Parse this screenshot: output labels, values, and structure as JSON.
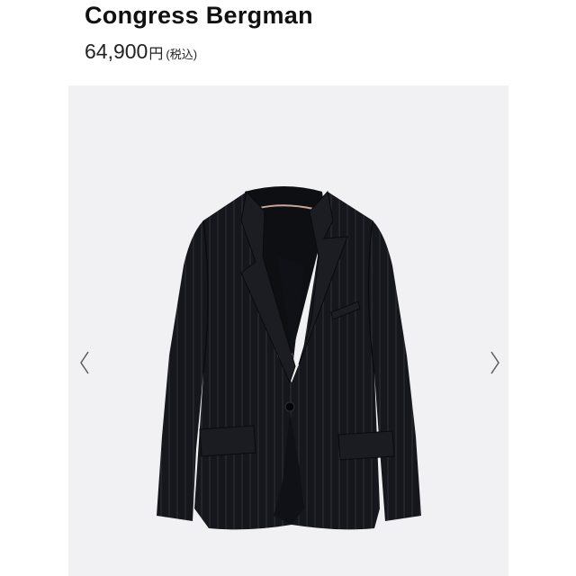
{
  "product": {
    "title": "Congress Bergman",
    "price": "64,900",
    "currency": "円",
    "tax_note": "(税込)"
  },
  "gallery": {
    "image_subject": "jacket-photo",
    "prev_icon": "chevron-left-icon",
    "next_icon": "chevron-right-icon",
    "background_color": "#f1f0f2",
    "garment_color": "#16171c",
    "stripe_color": "#3a3c46"
  }
}
